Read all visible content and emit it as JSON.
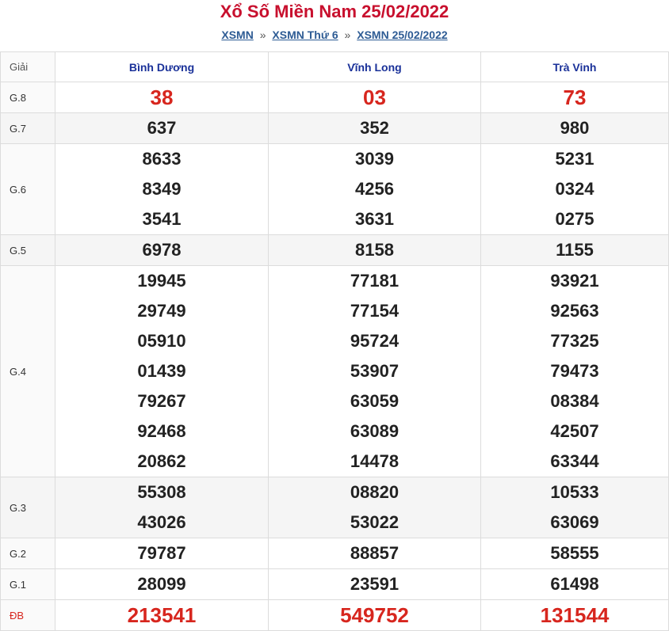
{
  "header": {
    "title": "Xổ Số Miền Nam 25/02/2022",
    "breadcrumb": [
      "XSMN",
      "XSMN Thứ 6",
      "XSMN 25/02/2022"
    ],
    "separator": "»"
  },
  "table": {
    "giai_header": "Giải",
    "provinces": [
      "Bình Dương",
      "Vĩnh Long",
      "Trà Vinh"
    ],
    "rows": [
      {
        "label": "G.8",
        "values": [
          [
            "38"
          ],
          [
            "03"
          ],
          [
            "73"
          ]
        ]
      },
      {
        "label": "G.7",
        "values": [
          [
            "637"
          ],
          [
            "352"
          ],
          [
            "980"
          ]
        ]
      },
      {
        "label": "G.6",
        "values": [
          [
            "8633",
            "8349",
            "3541"
          ],
          [
            "3039",
            "4256",
            "3631"
          ],
          [
            "5231",
            "0324",
            "0275"
          ]
        ]
      },
      {
        "label": "G.5",
        "values": [
          [
            "6978"
          ],
          [
            "8158"
          ],
          [
            "1155"
          ]
        ]
      },
      {
        "label": "G.4",
        "values": [
          [
            "19945",
            "29749",
            "05910",
            "01439",
            "79267",
            "92468",
            "20862"
          ],
          [
            "77181",
            "77154",
            "95724",
            "53907",
            "63059",
            "63089",
            "14478"
          ],
          [
            "93921",
            "92563",
            "77325",
            "79473",
            "08384",
            "42507",
            "63344"
          ]
        ]
      },
      {
        "label": "G.3",
        "values": [
          [
            "55308",
            "43026"
          ],
          [
            "08820",
            "53022"
          ],
          [
            "10533",
            "63069"
          ]
        ]
      },
      {
        "label": "G.2",
        "values": [
          [
            "79787"
          ],
          [
            "88857"
          ],
          [
            "58555"
          ]
        ]
      },
      {
        "label": "G.1",
        "values": [
          [
            "28099"
          ],
          [
            "23591"
          ],
          [
            "61498"
          ]
        ]
      },
      {
        "label": "ĐB",
        "values": [
          [
            "213541"
          ],
          [
            "549752"
          ],
          [
            "131544"
          ]
        ]
      }
    ]
  },
  "colors": {
    "title": "#c8102e",
    "province": "#1a3199",
    "prize_highlight": "#d7261e"
  }
}
